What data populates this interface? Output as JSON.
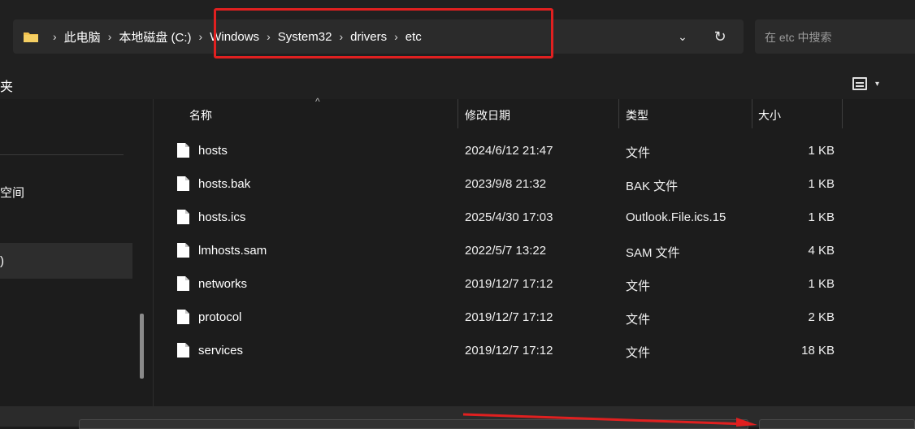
{
  "address": {
    "breadcrumb": [
      "此电脑",
      "本地磁盘 (C:)",
      "Windows",
      "System32",
      "drivers",
      "etc"
    ],
    "separator": "›",
    "dropdown_glyph": "⌄",
    "refresh_glyph": "↻"
  },
  "search": {
    "placeholder": "在 etc 中搜索"
  },
  "sidebar": {
    "fragment_top": "夹",
    "fragment_mid": "空间",
    "fragment_selected": ")"
  },
  "toolbar": {
    "view_chevron": "▾"
  },
  "columns": {
    "name": "名称",
    "modified": "修改日期",
    "type": "类型",
    "size": "大小",
    "sort_glyph": "^"
  },
  "files": [
    {
      "name": "hosts",
      "modified": "2024/6/12 21:47",
      "type": "文件",
      "size": "1 KB"
    },
    {
      "name": "hosts.bak",
      "modified": "2023/9/8 21:32",
      "type": "BAK 文件",
      "size": "1 KB"
    },
    {
      "name": "hosts.ics",
      "modified": "2025/4/30 17:03",
      "type": "Outlook.File.ics.15",
      "size": "1 KB"
    },
    {
      "name": "lmhosts.sam",
      "modified": "2022/5/7 13:22",
      "type": "SAM 文件",
      "size": "4 KB"
    },
    {
      "name": "networks",
      "modified": "2019/12/7 17:12",
      "type": "文件",
      "size": "1 KB"
    },
    {
      "name": "protocol",
      "modified": "2019/12/7 17:12",
      "type": "文件",
      "size": "2 KB"
    },
    {
      "name": "services",
      "modified": "2019/12/7 17:12",
      "type": "文件",
      "size": "18 KB"
    }
  ],
  "colors": {
    "highlight_box": "#e02020",
    "folder_icon": "#f2c14e",
    "background": "#1c1c1c"
  },
  "icons": [
    "folder-icon",
    "chevron-down-icon",
    "refresh-icon",
    "list-view-icon",
    "file-icon",
    "red-arrow-annotation"
  ]
}
